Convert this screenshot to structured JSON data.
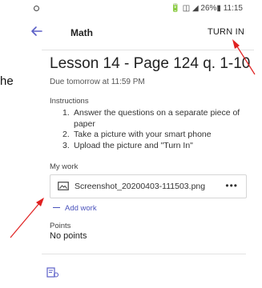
{
  "margin_text": "he",
  "status_bar": {
    "right_text": "🔋 ◫ ◢ 26%▮ 11:15"
  },
  "app_bar": {
    "title": "Math",
    "turn_in_label": "TURN IN"
  },
  "assignment": {
    "title": "Lesson 14 - Page 124 q. 1-10",
    "due": "Due tomorrow at 11:59 PM",
    "instructions_label": "Instructions",
    "instructions": [
      {
        "num": "1.",
        "text": "Answer the questions on a separate piece of paper"
      },
      {
        "num": "2.",
        "text": "Take a picture with your smart phone"
      },
      {
        "num": "3.",
        "text": "Upload the picture and \"Turn In\""
      }
    ],
    "my_work_label": "My work",
    "file_name": "Screenshot_20200403-111503.png",
    "more_label": "•••",
    "add_work_label": "Add work",
    "points_label": "Points",
    "points_value": "No points"
  },
  "icons": {
    "back": "arrow-left-icon",
    "file": "image-file-icon",
    "more": "more-options-icon",
    "bottom": "immersive-reader-icon"
  },
  "colors": {
    "accent": "#4b53bc",
    "annotation_arrow": "#e02020"
  }
}
